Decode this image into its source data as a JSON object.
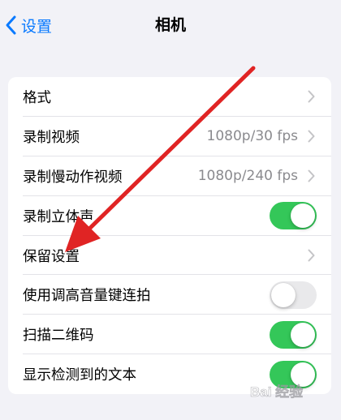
{
  "navbar": {
    "back_label": "设置",
    "title": "相机"
  },
  "rows": [
    {
      "label": "格式",
      "type": "link",
      "value": ""
    },
    {
      "label": "录制视频",
      "type": "link",
      "value": "1080p/30 fps"
    },
    {
      "label": "录制慢动作视频",
      "type": "link",
      "value": "1080p/240 fps"
    },
    {
      "label": "录制立体声",
      "type": "toggle",
      "on": true
    },
    {
      "label": "保留设置",
      "type": "link",
      "value": ""
    },
    {
      "label": "使用调高音量键连拍",
      "type": "toggle",
      "on": false
    },
    {
      "label": "扫描二维码",
      "type": "toggle",
      "on": true
    },
    {
      "label": "显示检测到的文本",
      "type": "toggle",
      "on": true
    }
  ],
  "colors": {
    "accent": "#0a7aff",
    "toggle_on": "#34c759",
    "toggle_off": "#e9e9eb",
    "annotation_arrow": "#e02424"
  },
  "icons": {
    "back": "chevron-left-icon",
    "disclosure": "chevron-right-icon",
    "annotation": "red-arrow-icon",
    "watermark": "baidu-watermark-logo"
  },
  "watermark": {
    "text": "Bai 经验"
  }
}
